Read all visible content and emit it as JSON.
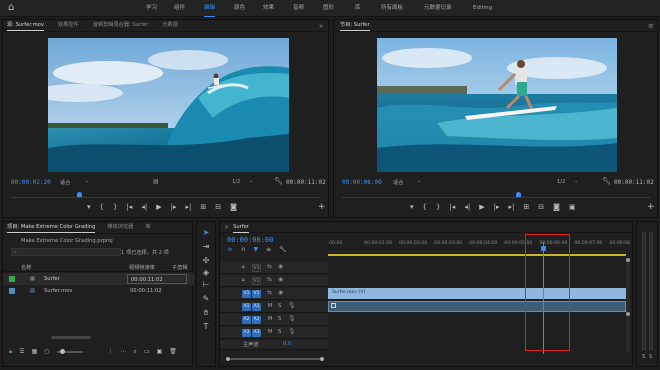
{
  "workspaces": {
    "items": [
      "学习",
      "组件",
      "编辑",
      "颜色",
      "效果",
      "音频",
      "图形",
      "库",
      "所有面板",
      "元数据记录",
      "Editing"
    ],
    "active": "编辑"
  },
  "source_monitor": {
    "tabs": [
      "源: Surfer.mov",
      "效果控件",
      "音频剪辑混合器: Surfer",
      "元数据"
    ],
    "current_time": "00:00:02:20",
    "fit_label": "适合",
    "resolution": "1/2",
    "duration": "00:00:11:02",
    "playhead_fraction": 0.22
  },
  "program_monitor": {
    "tab": "节目: Surfer",
    "current_time": "00:00:06:00",
    "fit_label": "适合",
    "resolution": "1/2",
    "duration": "00:00:11:02",
    "playhead_fraction": 0.57
  },
  "project_panel": {
    "tabs": [
      "项目: Make Extreme Color Grading",
      "媒体浏览器",
      "库"
    ],
    "file_name": "Make Extreme Color Grading.prproj",
    "selection_info": "1 项已选择，共 2 项",
    "columns": {
      "name": "名称",
      "frame_rate": "视频帧速率",
      "media_start": "媒体开始",
      "extra": "子剪辑"
    },
    "rows": [
      {
        "name": "Surfer",
        "value": "00:00:11:02",
        "color": "#35a84a"
      },
      {
        "name": "Surfer.mov",
        "value": "00:00:11:02",
        "color": "#4a90c8"
      }
    ]
  },
  "timeline": {
    "tab": "Surfer",
    "current_time": "00:00:06:00",
    "ruler_ticks": [
      "00:00",
      "00:00:01:00",
      "00:00:02:00",
      "00:00:03:00",
      "00:00:04:00",
      "00:00:05:00",
      "00:00:06:00",
      "00:00:07:00",
      "00:00:08"
    ],
    "video_tracks": [
      "V3",
      "V2",
      "V1"
    ],
    "audio_tracks": [
      "A1",
      "A2",
      "A3"
    ],
    "clip_label": "Surfer.mov [V]",
    "master_label": "主声道",
    "master_value": "0.0",
    "playhead_fraction": 0.72,
    "meter_labels": [
      "S",
      "S"
    ]
  }
}
